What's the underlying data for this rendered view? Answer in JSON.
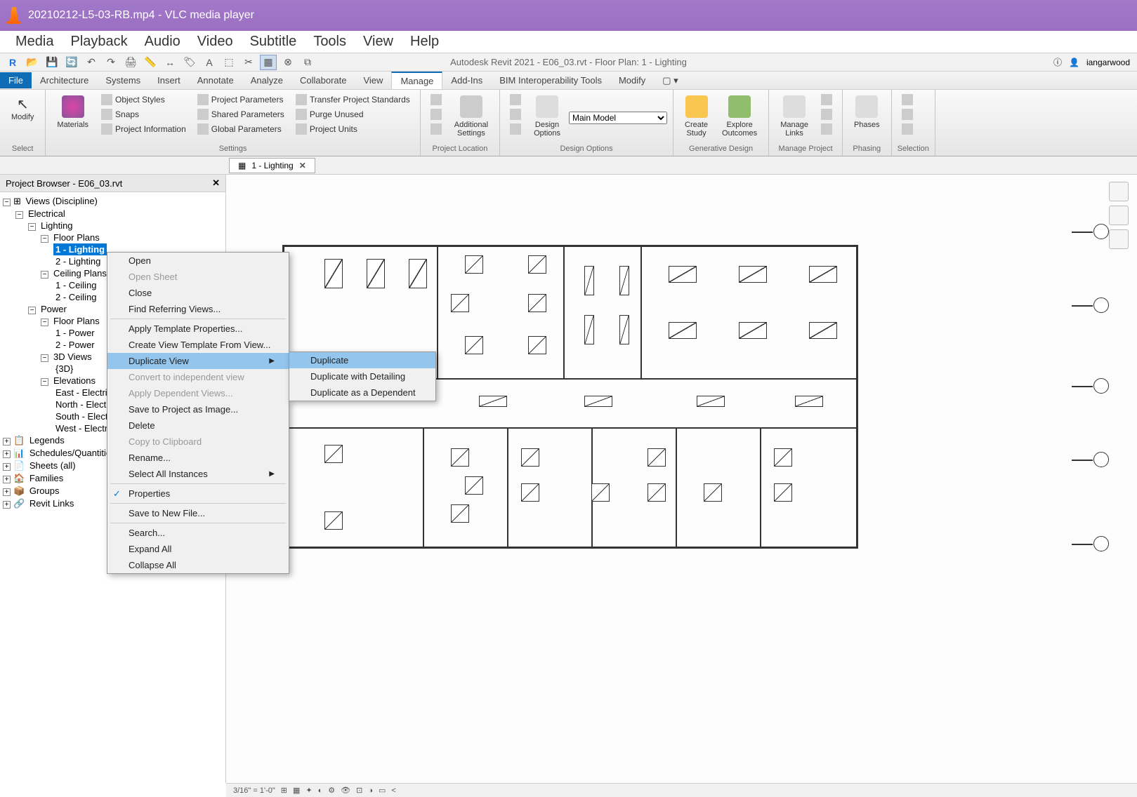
{
  "vlc": {
    "title": "20210212-L5-03-RB.mp4 - VLC media player",
    "menu": [
      "Media",
      "Playback",
      "Audio",
      "Video",
      "Subtitle",
      "Tools",
      "View",
      "Help"
    ]
  },
  "revit": {
    "qat_title": "Autodesk Revit 2021 - E06_03.rvt - Floor Plan: 1 - Lighting",
    "user": "iangarwood",
    "tabs": [
      "File",
      "Architecture",
      "Systems",
      "Insert",
      "Annotate",
      "Analyze",
      "Collaborate",
      "View",
      "Manage",
      "Add-Ins",
      "BIM Interoperability Tools",
      "Modify"
    ],
    "active_tab": "Manage",
    "ribbon": {
      "select_label": "Select",
      "modify": "Modify",
      "materials": "Materials",
      "object_styles": "Object Styles",
      "snaps": "Snaps",
      "project_info": "Project Information",
      "project_params": "Project Parameters",
      "shared_params": "Shared Parameters",
      "global_params": "Global Parameters",
      "transfer_standards": "Transfer Project Standards",
      "purge_unused": "Purge Unused",
      "project_units": "Project Units",
      "settings_label": "Settings",
      "additional_settings": "Additional\nSettings",
      "project_location": "Project Location",
      "design_options_btn": "Design\nOptions",
      "main_model": "Main Model",
      "design_options_label": "Design Options",
      "create_study": "Create\nStudy",
      "explore_outcomes": "Explore\nOutcomes",
      "generative_design": "Generative Design",
      "manage_links": "Manage\nLinks",
      "manage_project": "Manage Project",
      "phases": "Phases",
      "phasing": "Phasing",
      "selection": "Selection"
    },
    "view_tab": {
      "icon": "📐",
      "label": "1 - Lighting"
    },
    "project_browser": {
      "title": "Project Browser - E06_03.rvt",
      "tree": {
        "root": "Views (Discipline)",
        "electrical": "Electrical",
        "lighting": "Lighting",
        "floor_plans": "Floor Plans",
        "fp1": "1 - Lighting",
        "fp2": "2 - Lighting",
        "ceiling_plans": "Ceiling Plans",
        "cp1": "1 - Ceiling",
        "cp2": "2 - Ceiling",
        "power": "Power",
        "power_fp": "Floor Plans",
        "pfp1": "1 - Power",
        "pfp2": "2 - Power",
        "views3d": "3D Views",
        "v3d": "{3D}",
        "elevations": "Elevations",
        "east": "East - Electrical",
        "north": "North - Electrical",
        "south": "South - Electrical",
        "west": "West - Electrical",
        "legends": "Legends",
        "schedules": "Schedules/Quantities",
        "sheets": "Sheets (all)",
        "families": "Families",
        "groups": "Groups",
        "revit_links": "Revit Links"
      }
    },
    "context_menu": {
      "open": "Open",
      "open_sheet": "Open Sheet",
      "close": "Close",
      "find_referring": "Find Referring Views...",
      "apply_template": "Apply Template Properties...",
      "create_template": "Create View Template From View...",
      "duplicate_view": "Duplicate View",
      "convert_independent": "Convert to independent view",
      "apply_dependent": "Apply Dependent Views...",
      "save_image": "Save to Project as Image...",
      "delete": "Delete",
      "copy_clipboard": "Copy to Clipboard",
      "rename": "Rename...",
      "select_all": "Select All Instances",
      "properties": "Properties",
      "save_new_file": "Save to New File...",
      "search": "Search...",
      "expand_all": "Expand All",
      "collapse_all": "Collapse All",
      "submenu": {
        "duplicate": "Duplicate",
        "duplicate_detailing": "Duplicate with Detailing",
        "duplicate_dependent": "Duplicate as a Dependent"
      }
    },
    "status": {
      "scale": "3/16\" = 1'-0\""
    }
  }
}
